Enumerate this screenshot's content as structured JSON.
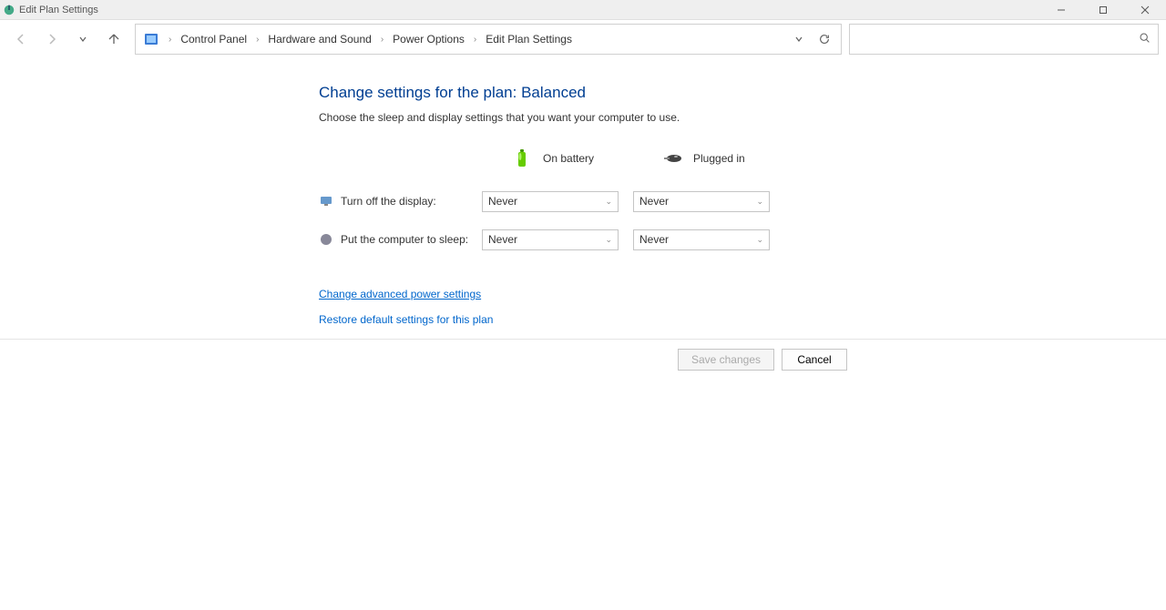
{
  "window": {
    "title": "Edit Plan Settings"
  },
  "breadcrumb": {
    "items": [
      "Control Panel",
      "Hardware and Sound",
      "Power Options",
      "Edit Plan Settings"
    ]
  },
  "page": {
    "title": "Change settings for the plan: Balanced",
    "subtitle": "Choose the sleep and display settings that you want your computer to use."
  },
  "columns": {
    "battery": "On battery",
    "plugged": "Plugged in"
  },
  "settings": {
    "display_off": {
      "label": "Turn off the display:",
      "battery_value": "Never",
      "plugged_value": "Never"
    },
    "sleep": {
      "label": "Put the computer to sleep:",
      "battery_value": "Never",
      "plugged_value": "Never"
    }
  },
  "links": {
    "advanced": "Change advanced power settings",
    "restore": "Restore default settings for this plan"
  },
  "footer": {
    "save": "Save changes",
    "cancel": "Cancel"
  }
}
